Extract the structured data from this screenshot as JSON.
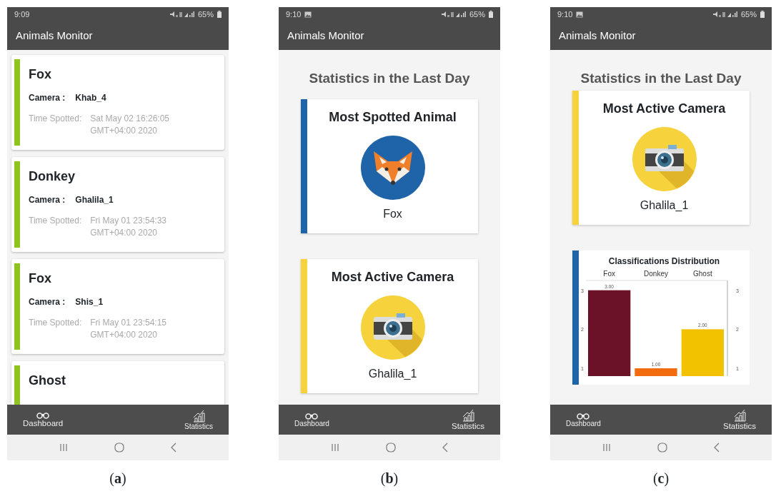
{
  "panels": [
    {
      "caption": "(**a**)",
      "status_bar": {
        "time": "9:09",
        "image_notice": false,
        "battery": "65%"
      },
      "app_bar": {
        "title": "Animals Monitor"
      },
      "screen": {
        "kind": "dashboard",
        "cards": [
          {
            "animal": "Fox",
            "camera_label": "Camera :",
            "camera": "Khab_4",
            "time_label": "Time Spotted:",
            "time": "Sat May 02 16:26:05 GMT+04:00 2020"
          },
          {
            "animal": "Donkey",
            "camera_label": "Camera :",
            "camera": "Ghalila_1",
            "time_label": "Time Spotted:",
            "time": "Fri May 01 23:54:33 GMT+04:00 2020"
          },
          {
            "animal": "Fox",
            "camera_label": "Camera :",
            "camera": "Shis_1",
            "time_label": "Time Spotted:",
            "time": "Fri May 01 23:54:15 GMT+04:00 2020"
          },
          {
            "animal": "Ghost"
          }
        ]
      },
      "bottom_nav": [
        {
          "label": "Dashboard",
          "selected": true
        },
        {
          "label": "Statistics",
          "selected": false
        }
      ]
    },
    {
      "caption": "(**b**)",
      "status_bar": {
        "time": "9:10",
        "image_notice": true,
        "battery": "65%"
      },
      "app_bar": {
        "title": "Animals Monitor"
      },
      "screen": {
        "kind": "statistics",
        "title": "Statistics in the Last Day",
        "cards": [
          {
            "kind": "animal",
            "title": "Most Spotted Animal",
            "value": "Fox",
            "color": "#1f63a8"
          },
          {
            "kind": "camera",
            "title": "Most Active Camera",
            "value": "Ghalila_1",
            "color": "#f6d23c"
          }
        ]
      },
      "bottom_nav": [
        {
          "label": "Dashboard",
          "selected": false
        },
        {
          "label": "Statistics",
          "selected": true
        }
      ]
    },
    {
      "caption": "(**c**)",
      "status_bar": {
        "time": "9:10",
        "image_notice": true,
        "battery": "65%"
      },
      "app_bar": {
        "title": "Animals Monitor"
      },
      "screen": {
        "kind": "statistics",
        "title": "Statistics in the Last Day",
        "cards": [
          {
            "kind": "camera",
            "title": "Most Active Camera",
            "value": "Ghalila_1",
            "color": "#f6d23c"
          },
          {
            "kind": "chart",
            "color": "#1f63a8",
            "chart_data": {
              "type": "bar",
              "title": "Classifications Distribution",
              "categories": [
                "Fox",
                "Donkey",
                "Ghost"
              ],
              "ylim": [
                0.8,
                3.25
              ],
              "yticks": [
                1,
                2,
                3
              ],
              "annotations": [
                "1",
                "2",
                "3"
              ],
              "value_labels": [
                "3.00",
                "1.00",
                "2.00"
              ],
              "series": [
                {
                  "color": "#6b1228",
                  "values": [
                    3,
                    null,
                    null
                  ]
                },
                {
                  "color": "#f26b0f",
                  "values": [
                    null,
                    1,
                    null
                  ]
                },
                {
                  "color": "#f2c200",
                  "values": [
                    null,
                    null,
                    2
                  ]
                }
              ]
            }
          }
        ]
      },
      "bottom_nav": [
        {
          "label": "Dashboard",
          "selected": false
        },
        {
          "label": "Statistics",
          "selected": true
        }
      ]
    }
  ]
}
